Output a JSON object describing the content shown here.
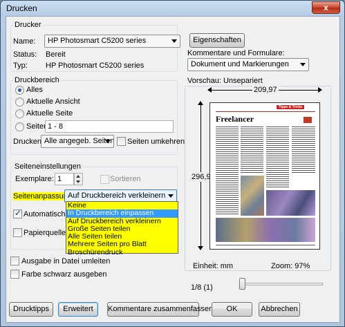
{
  "window": {
    "title": "Drucken",
    "close_symbol": "x"
  },
  "printer": {
    "group_label": "Drucker",
    "name_label": "Name:",
    "name_value": "HP Photosmart C5200 series",
    "properties_button": "Eigenschaften",
    "status_label": "Status:",
    "status_value": "Bereit",
    "type_label": "Typ:",
    "type_value": "HP Photosmart C5200 series",
    "comments_label": "Kommentare und Formulare:",
    "comments_value": "Dokument und Markierungen"
  },
  "range": {
    "group_label": "Druckbereich",
    "all": "Alles",
    "current_view": "Aktuelle Ansicht",
    "current_page": "Aktuelle Seite",
    "pages": "Seiten",
    "pages_value": "1 - 8",
    "print_label": "Drucken:",
    "print_value": "Alle angegeb. Seiten",
    "reverse_pages": "Seiten umkehren"
  },
  "page_setup": {
    "group_label": "Seiteneinstellungen",
    "copies_label": "Exemplare:",
    "copies_value": "1",
    "collate": "Sortieren",
    "scaling_label": "Seitenanpassung:",
    "scaling_value": "Auf Druckbereich verkleinern",
    "auto_rotate": "Automatisch dr",
    "paper_source": "Papierquelle ar",
    "options": [
      "Keine",
      "In Druckbereich einpassen",
      "Auf Druckbereich verkleinern",
      "Große Seiten teilen",
      "Alle Seiten teilen",
      "Mehrere Seiten pro Blatt",
      "Broschürendruck"
    ]
  },
  "output": {
    "print_to_file": "Ausgabe in Datei umleiten",
    "color_as_black": "Farbe schwarz ausgeben"
  },
  "preview": {
    "label": "Vorschau: Unsepariert",
    "width_value": "209,97",
    "height_value": "296,97",
    "units": "Einheit: mm",
    "zoom": "Zoom:  97%",
    "page_counter": "1/8 (1)",
    "doc_title": "Freelancer",
    "doc_header": "Tipps & Tricks"
  },
  "buttons": {
    "print_tips": "Drucktipps",
    "advanced": "Erweitert",
    "summarize_comments": "Kommentare zusammenfassen",
    "ok": "OK",
    "cancel": "Abbrechen"
  }
}
